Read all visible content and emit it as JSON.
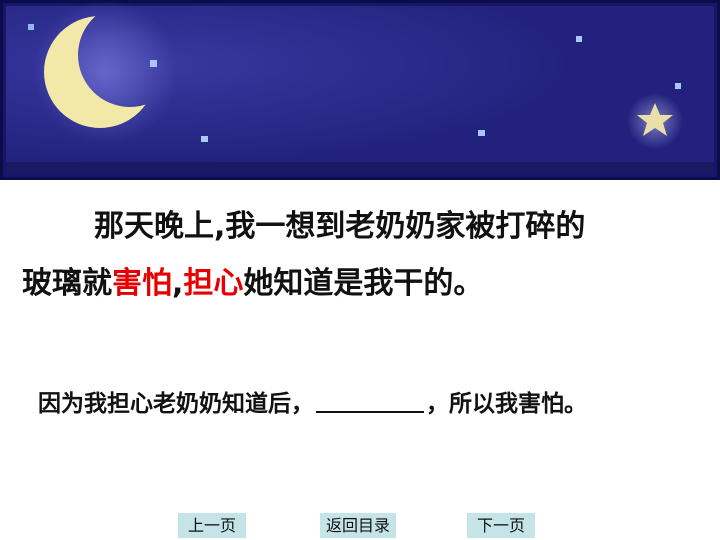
{
  "passage": {
    "line1": "那天晚上,我一想到老奶奶家被打碎的",
    "line2_part1": "玻璃就",
    "line2_red1": "害怕",
    "line2_sep": ",",
    "line2_red2": "担心",
    "line2_part2": "她知道是我干的。"
  },
  "question": {
    "before": "因为我担心老奶奶知道后，",
    "after": "，所以我害怕。"
  },
  "navigation": {
    "prev_label": "上一页",
    "toc_label": "返回目录",
    "next_label": "下一页"
  },
  "colors": {
    "sky": "#20207a",
    "moon": "#f2e8a8",
    "highlight": "#e60000",
    "button": "#c4e4e8"
  },
  "icons": {
    "banner": "night-sky-moon-star"
  }
}
